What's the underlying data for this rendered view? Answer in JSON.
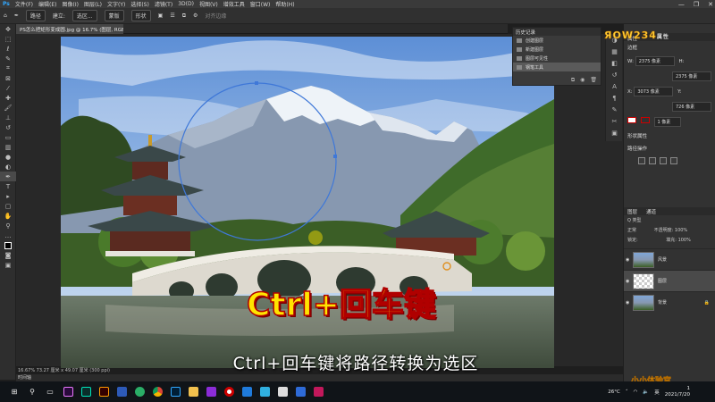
{
  "menubar": {
    "items": [
      "文件(F)",
      "编辑(E)",
      "图像(I)",
      "图层(L)",
      "文字(Y)",
      "选择(S)",
      "滤镜(T)",
      "3D(D)",
      "视图(V)",
      "增效工具",
      "窗口(W)",
      "帮助(H)"
    ],
    "minimize": "—",
    "maximize": "❐",
    "close": "✕"
  },
  "options": {
    "mode": "路径",
    "make_label": "建立:",
    "selection_btn": "选区...",
    "mask_btn": "蒙版",
    "shape_btn": "形状",
    "align_edges": "对齐边缘"
  },
  "document": {
    "tab_title": "PS怎么把矩形变成圆.jpg @ 16.7% (图层, RGB/8) *",
    "status": "16.67%  73.27 厘米 x 49.07 厘米 (300 ppi)",
    "timeline_label": "时间轴"
  },
  "overlay": {
    "hint": "Ctrl+回车键",
    "subtitle": "Ctrl+回车键将路径转换为选区"
  },
  "history": {
    "title": "历史记录",
    "items": [
      "创建图层",
      "新建图层",
      "图层可见性",
      "钢笔工具"
    ],
    "selected_index": 3
  },
  "properties": {
    "title": "属性",
    "section": "边框",
    "w_label": "W:",
    "w_value": "2375 像素",
    "h_label": "H:",
    "h_value": "2375 像素",
    "x_label": "X:",
    "x_value": "3073 像素",
    "y_label": "Y:",
    "y_value": "726 像素",
    "stroke": "1 像素",
    "shape_section": "形状属性",
    "path_ops": "路径操作"
  },
  "layers": {
    "tabs": [
      "图层",
      "通道"
    ],
    "kind_label": "Q 类型",
    "blend": "正常",
    "opacity_label": "不透明度:",
    "opacity": "100%",
    "lock_label": "锁定:",
    "fill_label": "填充:",
    "fill": "100%",
    "items": [
      {
        "name": "风景",
        "selected": false
      },
      {
        "name": "图层",
        "selected": true
      },
      {
        "name": "背景",
        "selected": false
      }
    ]
  },
  "taskbar": {
    "temp": "26°C",
    "time": "1",
    "date": "2021/7/20",
    "lang": "英"
  },
  "branding": {
    "logo": "ЯOW234",
    "logo_suffix": "属性",
    "watermark": "小小体验官"
  },
  "colors": {
    "hint_fill": "#ffe400",
    "hint_stroke": "#b00000",
    "path_stroke": "#3f78d8"
  }
}
